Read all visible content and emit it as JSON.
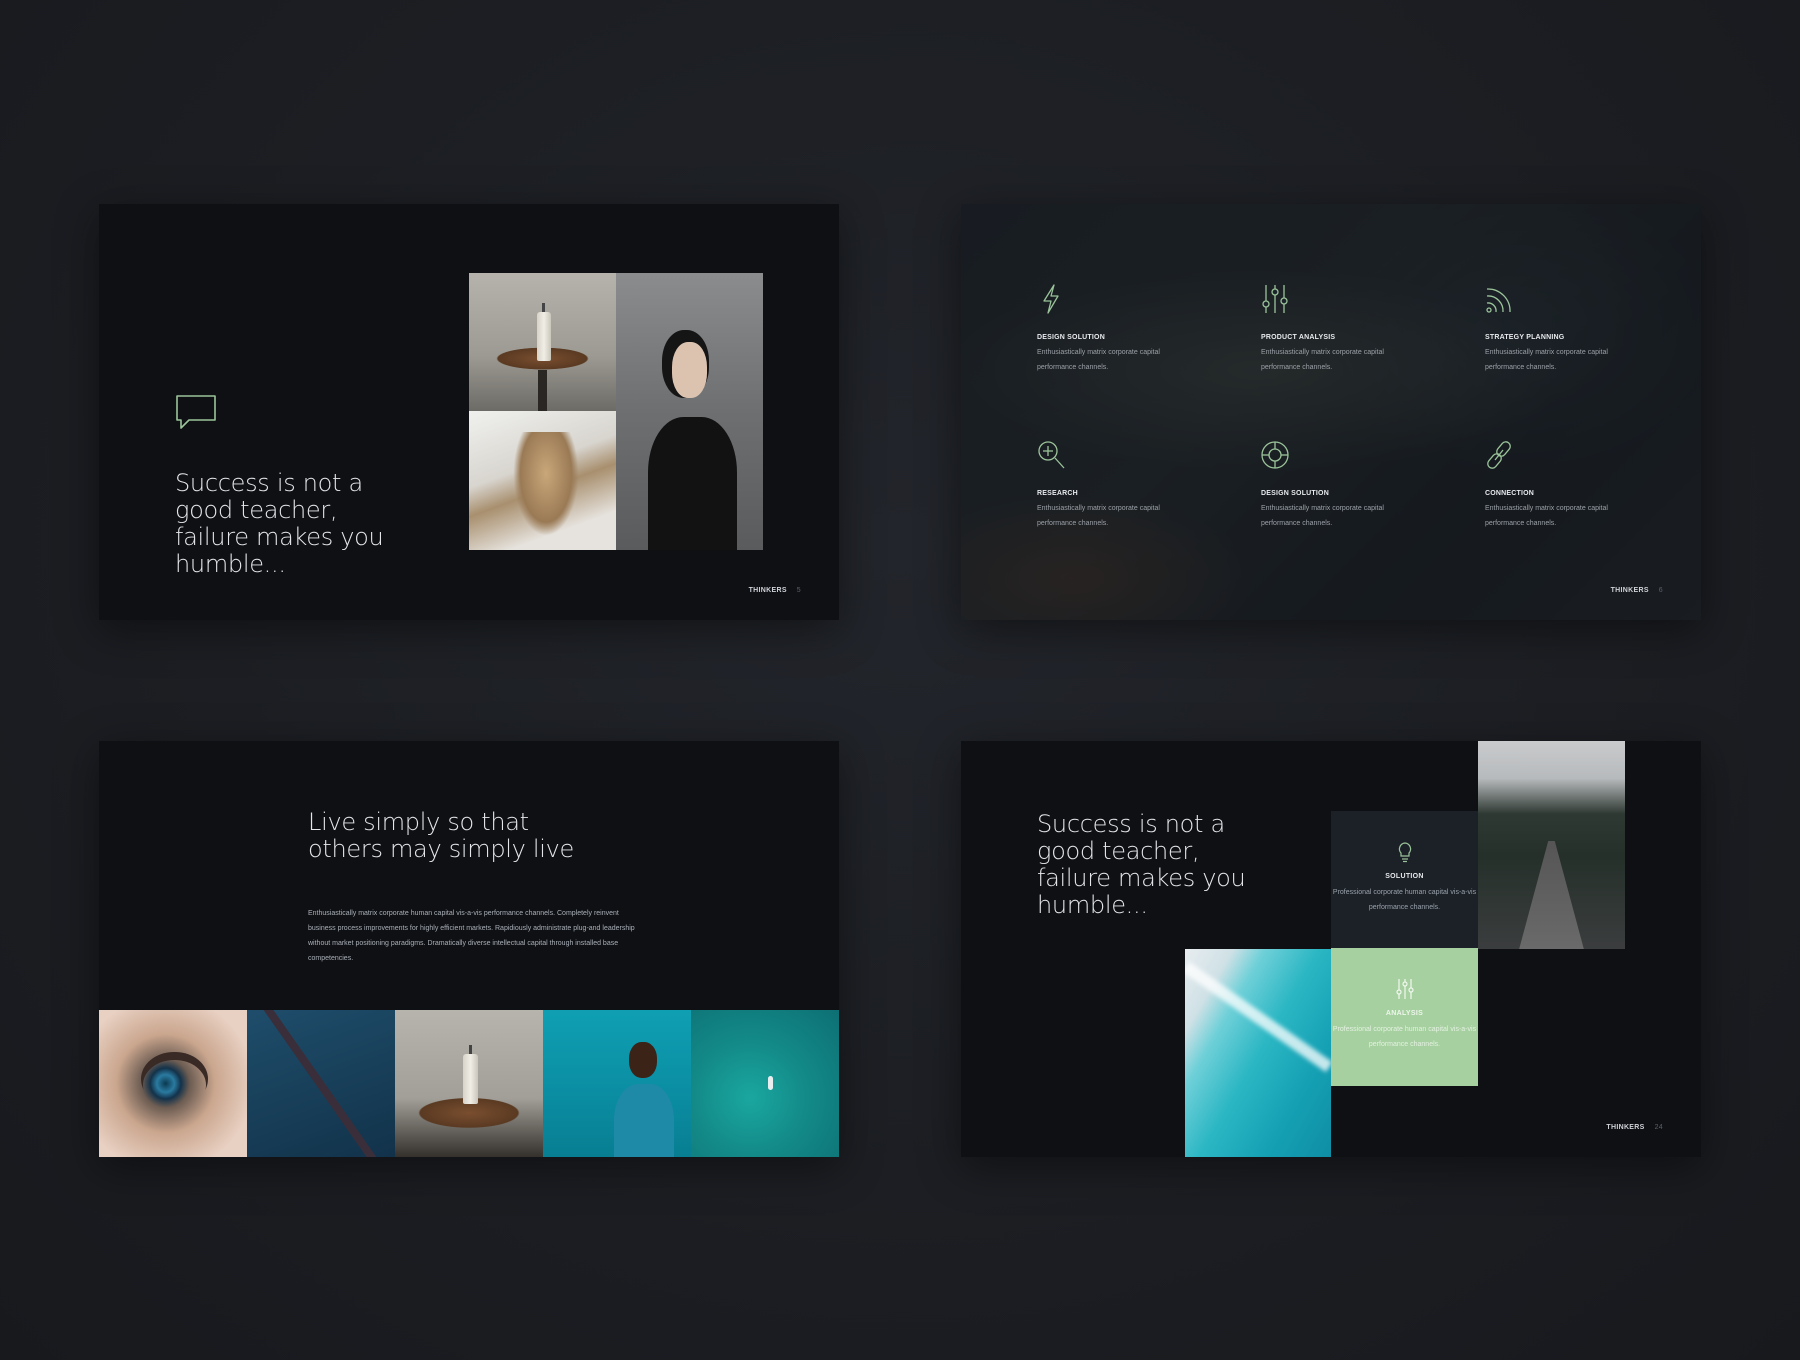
{
  "brand": "THINKERS",
  "colors": {
    "background": "#1c1e23",
    "slide": "#0e1014",
    "accent_green": "#a6d0a0"
  },
  "slide1": {
    "icon": "speech-bubble-icon",
    "quote": "Success is not a good teacher, failure makes you humble...",
    "footer_brand": "THINKERS",
    "page": "5"
  },
  "slide2": {
    "features": [
      {
        "icon": "lightning-icon",
        "title": "DESIGN SOLUTION",
        "text": "Enthusiastically matrix corporate capital performance channels."
      },
      {
        "icon": "sliders-icon",
        "title": "PRODUCT ANALYSIS",
        "text": "Enthusiastically matrix corporate capital performance channels."
      },
      {
        "icon": "signal-icon",
        "title": "STRATEGY PLANNING",
        "text": "Enthusiastically matrix corporate capital performance channels."
      },
      {
        "icon": "magnifier-icon",
        "title": "RESEARCH",
        "text": "Enthusiastically matrix corporate capital performance channels."
      },
      {
        "icon": "lifebuoy-icon",
        "title": "DESIGN SOLUTION",
        "text": "Enthusiastically matrix corporate capital performance channels."
      },
      {
        "icon": "link-icon",
        "title": "CONNECTION",
        "text": "Enthusiastically matrix corporate capital performance channels."
      }
    ],
    "footer_brand": "THINKERS",
    "page": "6"
  },
  "slide3": {
    "title": "Live simply so that others may simply live",
    "body": "Enthusiastically matrix corporate human capital vis-a-vis performance channels. Completely reinvent business process improvements for highly efficient markets. Rapidiously administrate plug-and leadership without market positioning paradigms. Dramatically diverse intellectual capital through installed base competencies."
  },
  "slide4": {
    "quote": "Success is not a good teacher, failure makes you humble...",
    "solution": {
      "icon": "lightbulb-icon",
      "title": "SOLUTION",
      "text": "Professional corporate human capital vis-a-vis performance channels."
    },
    "analysis": {
      "icon": "sliders-icon",
      "title": "ANALYSIS",
      "text": "Professional corporate human capital vis-a-vis performance channels."
    },
    "footer_brand": "THINKERS",
    "page": "24"
  }
}
